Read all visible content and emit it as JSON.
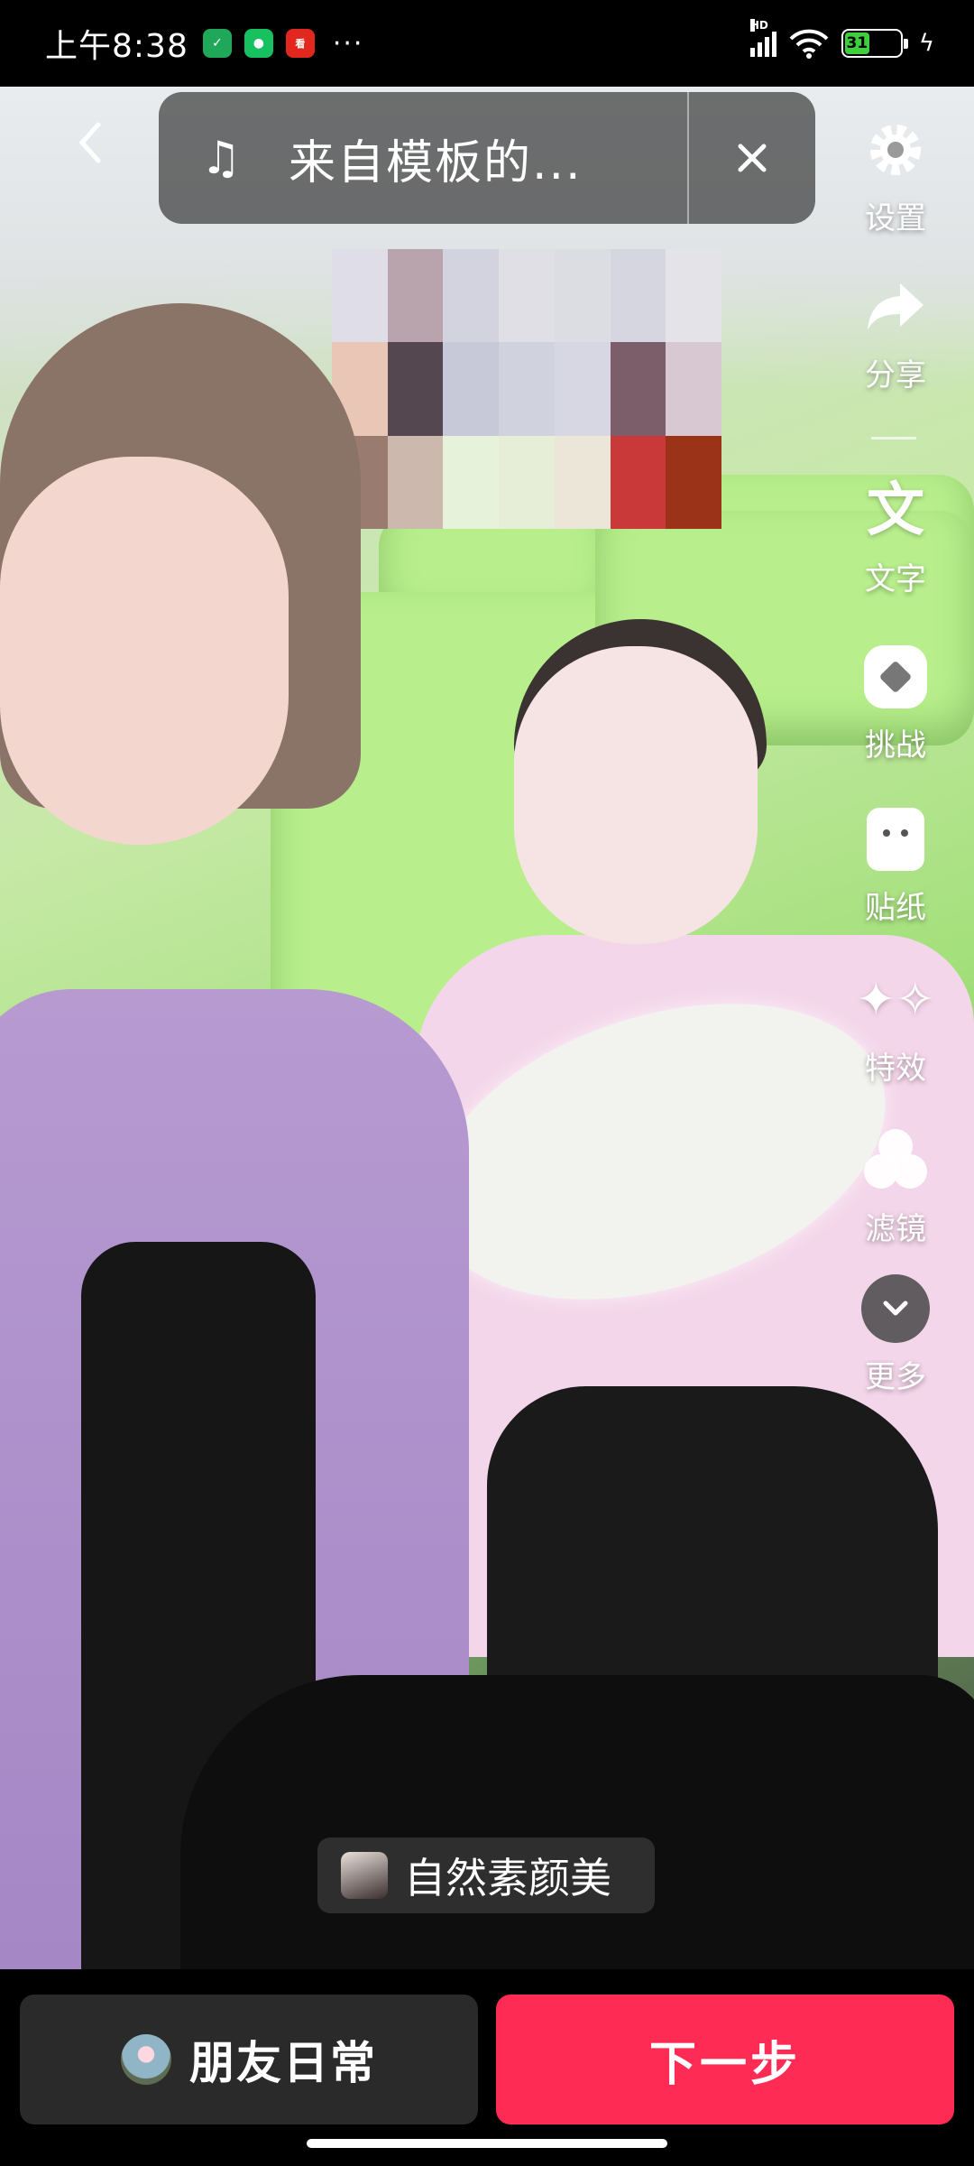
{
  "status_bar": {
    "time": "上午8:38",
    "network_label": "HD",
    "battery_level": 31,
    "battery_label": "31",
    "more_dots": "···"
  },
  "top": {
    "music_title": "来自模板的...",
    "music_icon": "music-note-icon",
    "close_icon": "close-icon",
    "back_icon": "back-chevron-icon"
  },
  "toolbar": {
    "items": [
      {
        "label": "设置",
        "icon": "gear-icon"
      },
      {
        "label": "分享",
        "icon": "share-arrow-icon"
      },
      {
        "label": "文字",
        "icon": "text-icon"
      },
      {
        "label": "挑战",
        "icon": "challenge-icon"
      },
      {
        "label": "贴纸",
        "icon": "sticker-icon"
      },
      {
        "label": "特效",
        "icon": "sparkle-icon"
      },
      {
        "label": "滤镜",
        "icon": "filter-icon"
      },
      {
        "label": "更多",
        "icon": "chevron-down-icon"
      }
    ]
  },
  "beauty": {
    "label": "自然素颜美"
  },
  "bottom": {
    "friends_label": "朋友日常",
    "next_label": "下一步"
  },
  "colors": {
    "accent": "#fe2c55",
    "secondary_button": "#2a2a2a",
    "pill_bg": "rgba(60,60,60,0.72)"
  }
}
